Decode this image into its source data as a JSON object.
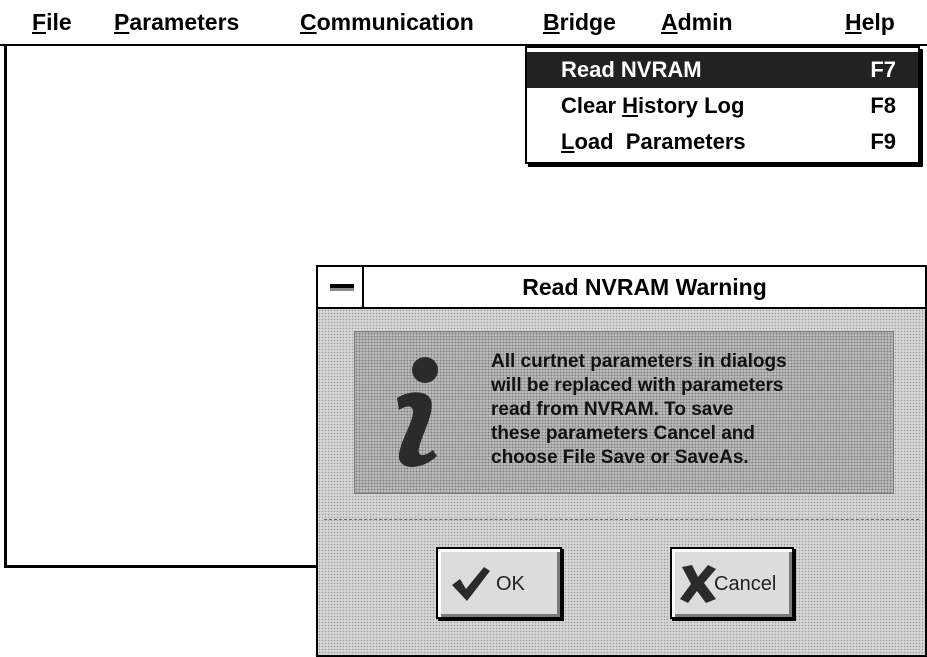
{
  "menubar": {
    "items": [
      {
        "label": "File",
        "accel": "F",
        "rest": "ile"
      },
      {
        "label": "Parameters",
        "accel": "P",
        "rest": "arameters"
      },
      {
        "label": "Communication",
        "accel": "C",
        "rest": "ommunication"
      },
      {
        "label": "Bridge",
        "accel": "B",
        "rest": "ridge"
      },
      {
        "label": "Admin",
        "accel": "A",
        "rest": "dmin"
      },
      {
        "label": "Help",
        "accel": "H",
        "rest": "elp"
      }
    ]
  },
  "bridge_menu": {
    "items": [
      {
        "pre": "",
        "accel": "",
        "post": "Read NVRAM",
        "shortcut": "F7",
        "highlighted": true
      },
      {
        "pre": "Clear ",
        "accel": "H",
        "post": "istory Log",
        "shortcut": "F8",
        "highlighted": false
      },
      {
        "pre": "",
        "accel": "L",
        "post": "oad  Parameters",
        "shortcut": "F9",
        "highlighted": false
      }
    ]
  },
  "dialog": {
    "title": "Read NVRAM Warning",
    "icon": "information-icon",
    "message_lines": [
      "All curtnet parameters in dialogs",
      "will be replaced with parameters",
      "read from NVRAM. To save",
      "these parameters Cancel and",
      "choose File Save or SaveAs."
    ],
    "ok_label": "OK",
    "cancel_label": "Cancel"
  },
  "colors": {
    "highlight": "#222222",
    "dialog_face": "#d6d6d6",
    "panel_face": "#b8b8b8",
    "ok_check": "#2a2a2a",
    "cancel_x": "#2a2a2a"
  }
}
